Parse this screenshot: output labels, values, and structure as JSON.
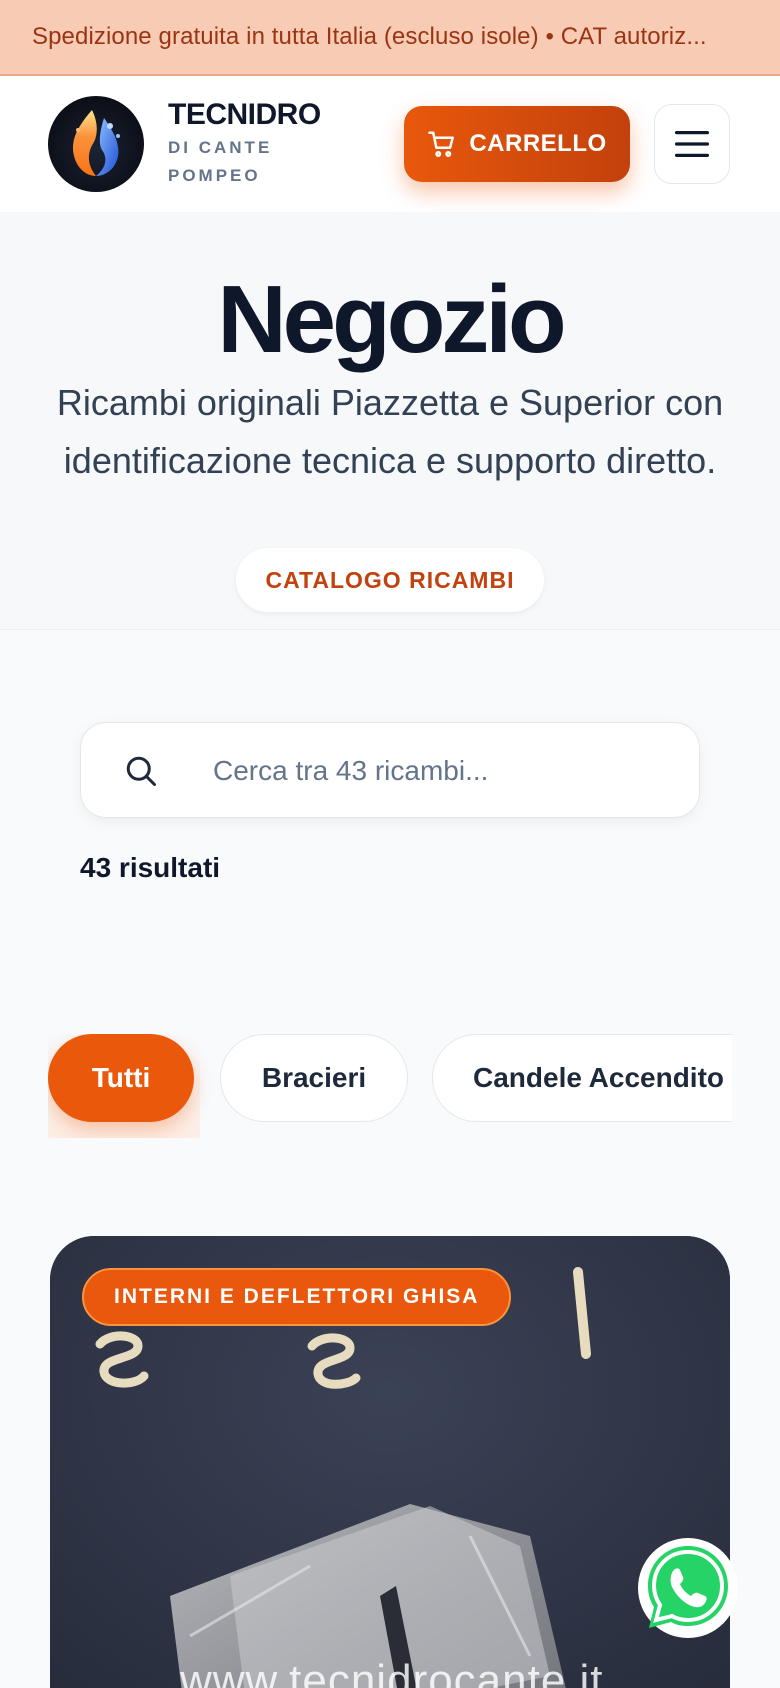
{
  "announcement": {
    "text": "Spedizione gratuita in tutta Italia (escluso isole) • CAT autoriz..."
  },
  "header": {
    "brand_name": "TECNIDRO",
    "brand_sub": "DI CANTE POMPEO",
    "cart_label": "CARRELLO",
    "icons": {
      "cart": "cart-icon",
      "menu": "hamburger-menu-icon",
      "logo": "flame-water-logo"
    }
  },
  "hero": {
    "title": "Negozio",
    "subtitle": "Ricambi originali Piazzetta e Superior con identificazione tecnica e supporto diretto.",
    "pill": "CATALOGO RICAMBI"
  },
  "search": {
    "placeholder": "Cerca tra 43 ricambi...",
    "value": "",
    "icon": "search-icon"
  },
  "results": {
    "label": "43 risultati"
  },
  "filters": {
    "chips": [
      {
        "label": "Tutti",
        "active": true
      },
      {
        "label": "Bracieri",
        "active": false
      },
      {
        "label": "Candele Accendito",
        "active": false
      }
    ]
  },
  "product_card": {
    "badge": "INTERNI E DEFLETTORI GHISA",
    "image_watermark": "www.tecnidrocante.it"
  },
  "floating": {
    "whatsapp_icon": "whatsapp-icon"
  },
  "colors": {
    "accent": "#ea580c",
    "announcement_bg": "#f8ccb4",
    "announcement_text": "#9a3412",
    "pill_text": "#c2410c",
    "whatsapp": "#25d366"
  }
}
